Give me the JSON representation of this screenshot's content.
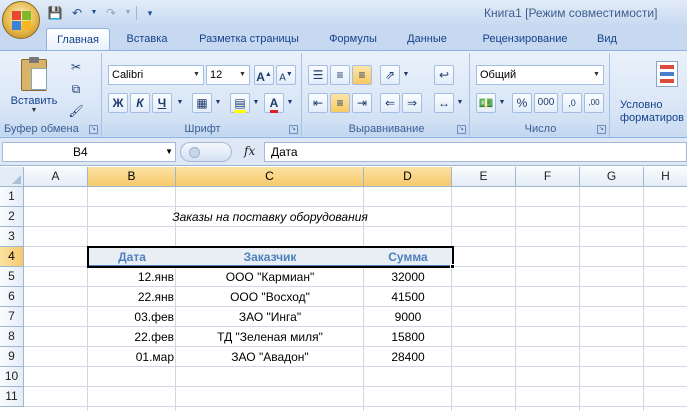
{
  "window": {
    "title": "Книга1  [Режим совместимости]"
  },
  "quick_access": {
    "save_icon": "save-icon",
    "undo_icon": "undo-icon",
    "redo_icon": "redo-icon",
    "customize_icon": "customize-icon"
  },
  "tabs": [
    {
      "label": "Главная",
      "active": true
    },
    {
      "label": "Вставка"
    },
    {
      "label": "Разметка страницы"
    },
    {
      "label": "Формулы"
    },
    {
      "label": "Данные"
    },
    {
      "label": "Рецензирование"
    },
    {
      "label": "Вид"
    }
  ],
  "ribbon": {
    "clipboard": {
      "label": "Буфер обмена",
      "paste_label": "Вставить"
    },
    "font": {
      "label": "Шрифт",
      "font_name": "Calibri",
      "font_size": "12",
      "bold": "Ж",
      "italic": "К",
      "underline": "Ч",
      "font_color": "A",
      "grow": "A",
      "shrink": "A"
    },
    "alignment": {
      "label": "Выравнивание"
    },
    "number": {
      "label": "Число",
      "format": "Общий",
      "percent": "%",
      "thousands": "000",
      "inc_decimal": ",0",
      "dec_decimal": ",00"
    },
    "styles": {
      "label_line1": "Условно",
      "label_line2": "форматиров"
    }
  },
  "formula_bar": {
    "name_box": "B4",
    "fx": "fx",
    "formula": "Дата"
  },
  "columns": [
    "A",
    "B",
    "C",
    "D",
    "E",
    "F",
    "G",
    "H"
  ],
  "rows": [
    "1",
    "2",
    "3",
    "4",
    "5",
    "6",
    "7",
    "8",
    "9",
    "10",
    "11"
  ],
  "sheet": {
    "title": "Заказы на поставку оборудования",
    "headers": [
      "Дата",
      "Заказчик",
      "Сумма"
    ],
    "data": [
      [
        "12.янв",
        "ООО \"Кармиан\"",
        "32000"
      ],
      [
        "22.янв",
        "ООО \"Восход\"",
        "41500"
      ],
      [
        "03.фев",
        "ЗАО \"Инга\"",
        "9000"
      ],
      [
        "22.фев",
        "ТД \"Зеленая миля\"",
        "15800"
      ],
      [
        "01.мар",
        "ЗАО \"Авадон\"",
        "28400"
      ]
    ]
  },
  "colors": {
    "accent": "#4f81bd",
    "selected_header": "#f7c96a",
    "ribbon_bg": "#dbe7f7"
  }
}
